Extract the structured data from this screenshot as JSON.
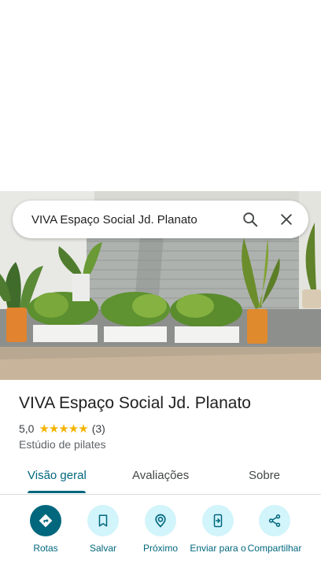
{
  "search": {
    "query": "VIVA Espaço Social Jd. Planato"
  },
  "icons": {
    "search": "search-icon",
    "close": "close-icon"
  },
  "place": {
    "title": "VIVA Espaço Social Jd. Planato",
    "rating_value": "5,0",
    "rating_stars": 5,
    "stars_text": "★★★★★",
    "review_count": "(3)",
    "category": "Estúdio de pilates"
  },
  "tabs": [
    {
      "label": "Visão geral",
      "active": true
    },
    {
      "label": "Avaliações",
      "active": false
    },
    {
      "label": "Sobre",
      "active": false
    }
  ],
  "actions": [
    {
      "label": "Rotas",
      "icon": "directions-icon"
    },
    {
      "label": "Salvar",
      "icon": "bookmark-icon"
    },
    {
      "label": "Próximo",
      "icon": "nearby-icon"
    },
    {
      "label": "Enviar para o",
      "icon": "send-to-phone-icon"
    },
    {
      "label": "Compartilhar",
      "icon": "share-icon"
    }
  ],
  "colors": {
    "accent": "#00677d",
    "accent_light": "#d2f4fb",
    "star": "#f4b400"
  }
}
